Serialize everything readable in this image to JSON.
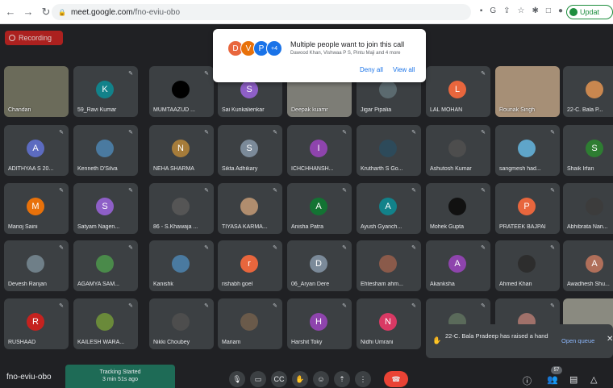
{
  "browser": {
    "url_host": "meet.google.com",
    "url_path": "/fno-eviu-obo",
    "update_label": "Updat"
  },
  "meet": {
    "recording_label": "Recording",
    "tiles": [
      {
        "name": "Chandan",
        "type": "video",
        "color": "#6b6b5a"
      },
      {
        "name": "59_Ravi Kumar",
        "initial": "K",
        "color": "#12828a"
      },
      {
        "name": "MUMTAAZUD ...",
        "initial": "",
        "color": "#000000"
      },
      {
        "name": "Sai Kunkalienkar",
        "initial": "S",
        "color": "#8e5fc7"
      },
      {
        "name": "Deepak kuamr",
        "type": "video",
        "color": "#7d7d76"
      },
      {
        "name": "Jigar Pipalia",
        "initial": "",
        "color": "#5b6a6f"
      },
      {
        "name": "LAL MOHAN",
        "initial": "L",
        "color": "#e8663d"
      },
      {
        "name": "Rounak Singh",
        "type": "video",
        "color": "#a68f76"
      },
      {
        "name": "22-C. Bala P...",
        "initial": "",
        "color": "#c9874f"
      },
      {
        "name": "ADITHYAA S 20...",
        "initial": "A",
        "color": "#5c6bc0"
      },
      {
        "name": "Kenneth D'Silva",
        "initial": "",
        "color": "#4a7aa0"
      },
      {
        "name": "NEHA SHARMA",
        "initial": "N",
        "color": "#a67c3a"
      },
      {
        "name": "Sikta Adhikary",
        "initial": "S",
        "color": "#7b8a99"
      },
      {
        "name": "ICHCHHANSH...",
        "initial": "I",
        "color": "#8e44ad"
      },
      {
        "name": "Krutharth S Go...",
        "initial": "",
        "color": "#2d4a5a"
      },
      {
        "name": "Ashutosh Kumar",
        "initial": "",
        "color": "#4d4d4d"
      },
      {
        "name": "sangmesh had...",
        "initial": "",
        "color": "#5fa5c9"
      },
      {
        "name": "Shaik Irfan",
        "initial": "S",
        "color": "#2e7d32"
      },
      {
        "name": "Manoj Saini",
        "initial": "M",
        "color": "#e8710a"
      },
      {
        "name": "Satyam Nagen...",
        "initial": "S",
        "color": "#8e5fc7"
      },
      {
        "name": "86 - S.Khawaja ...",
        "initial": "",
        "color": "#555555"
      },
      {
        "name": "TIYASA KARMA...",
        "initial": "",
        "color": "#b08d6e"
      },
      {
        "name": "Anisha Patra",
        "initial": "A",
        "color": "#137333"
      },
      {
        "name": "Ayush Gyanch...",
        "initial": "A",
        "color": "#12828a"
      },
      {
        "name": "Mohek Gupta",
        "initial": "",
        "color": "#111111"
      },
      {
        "name": "PRATEEK BAJPAI",
        "initial": "P",
        "color": "#e8663d"
      },
      {
        "name": "Abhibrata Nan...",
        "initial": "",
        "color": "#3c3c3c"
      },
      {
        "name": "Devesh Ranjan",
        "initial": "",
        "color": "#6f7f88"
      },
      {
        "name": "AGAMYA SAM...",
        "initial": "",
        "color": "#4a8a4a"
      },
      {
        "name": "Kanishk",
        "initial": "",
        "color": "#4a7aa0"
      },
      {
        "name": "rishabh goel",
        "initial": "r",
        "color": "#e8663d"
      },
      {
        "name": "06_Aryan Dere",
        "initial": "D",
        "color": "#7b8a99"
      },
      {
        "name": "Ehtesham ahm...",
        "initial": "",
        "color": "#8a5a4a"
      },
      {
        "name": "Akanksha",
        "initial": "A",
        "color": "#8e44ad"
      },
      {
        "name": "Ahmed Khan",
        "initial": "",
        "color": "#2d2d2d"
      },
      {
        "name": "Awadhesh Shu...",
        "initial": "A",
        "color": "#b06f5a"
      },
      {
        "name": "RUSHAAD",
        "initial": "R",
        "color": "#c5221f"
      },
      {
        "name": "KAILESH WARA...",
        "initial": "",
        "color": "#6a8a3a"
      },
      {
        "name": "Nikki Choubey",
        "initial": "",
        "color": "#4d4d4d"
      },
      {
        "name": "Mariam",
        "initial": "",
        "color": "#6a5a4a"
      },
      {
        "name": "Harshit Toky",
        "initial": "H",
        "color": "#8e44ad"
      },
      {
        "name": "Nidhi Umrani",
        "initial": "N",
        "color": "#d93964"
      },
      {
        "name": "",
        "initial": "",
        "color": "#5a6a5a"
      },
      {
        "name": "",
        "initial": "",
        "color": "#a0716a"
      },
      {
        "name": "",
        "type": "video",
        "color": "#8a8a80"
      }
    ],
    "join_notification": {
      "avatars": [
        {
          "letter": "D",
          "color": "#e8663d"
        },
        {
          "letter": "V",
          "color": "#e8710a"
        },
        {
          "letter": "P",
          "color": "#1a73e8"
        },
        {
          "letter": "+4",
          "color": "#1a73e8"
        }
      ],
      "title": "Multiple people want to join this call",
      "subtitle": "Dawood Khan, Vishwaa P S, Pintu Maji and 4 more",
      "deny_label": "Deny all",
      "view_label": "View all"
    },
    "hand_raise": {
      "text": "22-C. Bala Pradeep has raised a hand",
      "open_queue": "Open queue"
    },
    "bottom_bar": {
      "meeting_code": "fno-eviu-obo",
      "tracking_line1": "Tracking Started",
      "tracking_line2": "3 min 51s ago",
      "participant_count": "57"
    }
  }
}
